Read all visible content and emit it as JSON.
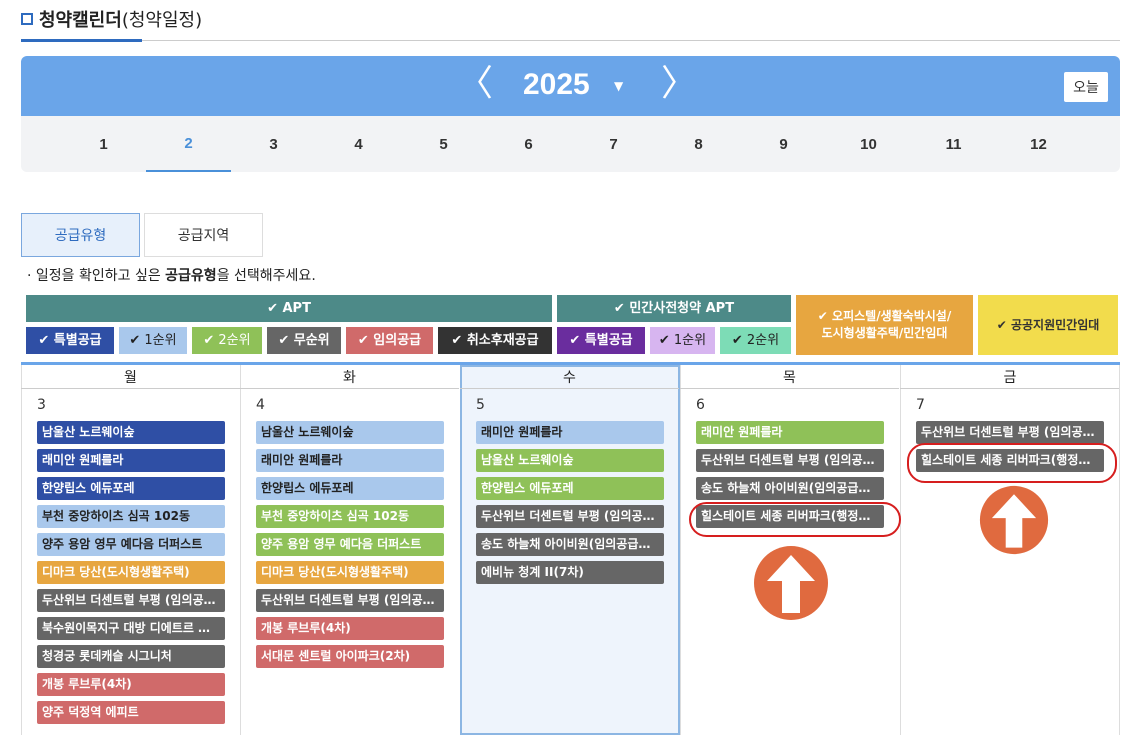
{
  "header": {
    "title": "청약캘린더",
    "title_paren": "(청약일정)"
  },
  "year_nav": {
    "prev": "〈",
    "year": "2025",
    "caret": "▼",
    "next": "〉",
    "today": "오늘"
  },
  "months": [
    "1",
    "2",
    "3",
    "4",
    "5",
    "6",
    "7",
    "8",
    "9",
    "10",
    "11",
    "12"
  ],
  "active_month": "2",
  "tabs": {
    "supply_type": "공급유형",
    "supply_region": "공급지역"
  },
  "note": {
    "prefix": "· 일정을 확인하고 싶은 ",
    "bold": "공급유형",
    "suffix": "을 선택해주세요."
  },
  "legend": {
    "apt": "✔ APT",
    "private_pre": "✔ 민간사전청약 APT",
    "officetel": "✔ 오피스텔/생활숙박시설/\n도시형생활주택/민간임대",
    "public_rental": "✔ 공공지원민간임대",
    "apt_items": [
      "✔ 특별공급",
      "✔ 1순위",
      "✔ 2순위",
      "✔ 무순위",
      "✔ 임의공급",
      "✔ 취소후재공급"
    ],
    "pre_items": [
      "✔ 특별공급",
      "✔ 1순위",
      "✔ 2순위"
    ]
  },
  "colors": {
    "special": "#2f4fa5",
    "rank1": "#a9c8ec",
    "rank2": "#8fc158",
    "no_rank": "#666666",
    "random": "#d06a6a",
    "cancel": "#333333",
    "pre_special": "#6a2d9e",
    "pre_rank1": "#d7b5f0",
    "pre_rank2": "#7ddcb6",
    "officetel": "#e7a640",
    "public": "#f2dc4c",
    "apt_header": "#4d8a88",
    "highlight": "#d61e1e",
    "arrow": "#e06a3f"
  },
  "weekdays": [
    "월",
    "화",
    "수",
    "목",
    "금"
  ],
  "days": [
    {
      "date": "3",
      "events": [
        {
          "text": "남울산 노르웨이숲",
          "type": "special"
        },
        {
          "text": "래미안 원페를라",
          "type": "special"
        },
        {
          "text": "한양립스 에듀포레",
          "type": "special"
        },
        {
          "text": "부천 중앙하이츠 심곡 102동",
          "type": "rank1"
        },
        {
          "text": "양주 용암 영무 예다음 더퍼스트",
          "type": "rank1"
        },
        {
          "text": "디마크 당산(도시형생활주택)",
          "type": "officetel"
        },
        {
          "text": "두산위브 더센트럴 부평 (임의공…",
          "type": "no_rank"
        },
        {
          "text": "북수원이목지구 대방 디에트르 …",
          "type": "no_rank"
        },
        {
          "text": "청경궁 롯데캐슬 시그니처",
          "type": "no_rank"
        },
        {
          "text": "개봉 루브루(4차)",
          "type": "random"
        },
        {
          "text": "양주 덕정역 에피트",
          "type": "random"
        }
      ]
    },
    {
      "date": "4",
      "events": [
        {
          "text": "남울산 노르웨이숲",
          "type": "rank1"
        },
        {
          "text": "래미안 원페를라",
          "type": "rank1"
        },
        {
          "text": "한양립스 에듀포레",
          "type": "rank1"
        },
        {
          "text": "부천 중앙하이츠 심곡 102동",
          "type": "rank2"
        },
        {
          "text": "양주 용암 영무 예다음 더퍼스트",
          "type": "rank2"
        },
        {
          "text": "디마크 당산(도시형생활주택)",
          "type": "officetel"
        },
        {
          "text": "두산위브 더센트럴 부평 (임의공…",
          "type": "no_rank"
        },
        {
          "text": "개봉 루브루(4차)",
          "type": "random"
        },
        {
          "text": "서대문 센트럴 아이파크(2차)",
          "type": "random"
        }
      ]
    },
    {
      "date": "5",
      "events": [
        {
          "text": "래미안 원페를라",
          "type": "rank1"
        },
        {
          "text": "남울산 노르웨이숲",
          "type": "rank2"
        },
        {
          "text": "한양립스 에듀포레",
          "type": "rank2"
        },
        {
          "text": "두산위브 더센트럴 부평 (임의공…",
          "type": "no_rank"
        },
        {
          "text": "송도 하늘채 아이비원(임의공급…",
          "type": "no_rank"
        },
        {
          "text": "에비뉴 청계 II(7차)",
          "type": "no_rank"
        }
      ]
    },
    {
      "date": "6",
      "events": [
        {
          "text": "래미안 원페를라",
          "type": "rank2"
        },
        {
          "text": "두산위브 더센트럴 부평 (임의공…",
          "type": "no_rank"
        },
        {
          "text": "송도 하늘채 아이비원(임의공급…",
          "type": "no_rank"
        },
        {
          "text": "힐스테이트 세종 리버파크(행정…",
          "type": "no_rank"
        }
      ]
    },
    {
      "date": "7",
      "events": [
        {
          "text": "두산위브 더센트럴 부평 (임의공…",
          "type": "no_rank"
        },
        {
          "text": "힐스테이트 세종 리버파크(행정…",
          "type": "no_rank"
        }
      ]
    }
  ]
}
